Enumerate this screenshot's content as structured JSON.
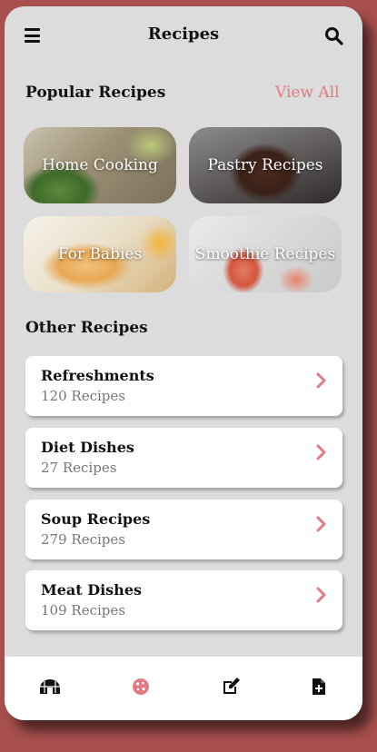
{
  "header": {
    "title": "Recipes",
    "menu_icon": "menu-icon",
    "search_icon": "search-icon"
  },
  "popular": {
    "title": "Popular Recipes",
    "view_all": "View All",
    "cards": [
      {
        "label": "Home Cooking"
      },
      {
        "label": "Pastry Recipes"
      },
      {
        "label": "For Babies"
      },
      {
        "label": "Smoothie Recipes"
      }
    ]
  },
  "other": {
    "title": "Other Recipes",
    "items": [
      {
        "name": "Refreshments",
        "count": "120 Recipes"
      },
      {
        "name": "Diet Dishes",
        "count": "27 Recipes"
      },
      {
        "name": "Soup Recipes",
        "count": "279 Recipes"
      },
      {
        "name": "Meat Dishes",
        "count": "109 Recipes"
      }
    ]
  },
  "bottom_nav": {
    "items": [
      {
        "icon": "igloo-icon"
      },
      {
        "icon": "cookie-icon",
        "active": true
      },
      {
        "icon": "edit-icon"
      },
      {
        "icon": "file-add-icon"
      }
    ]
  },
  "colors": {
    "accent": "#e07c80",
    "background": "#a8504e",
    "screen": "#dcdcdc"
  }
}
